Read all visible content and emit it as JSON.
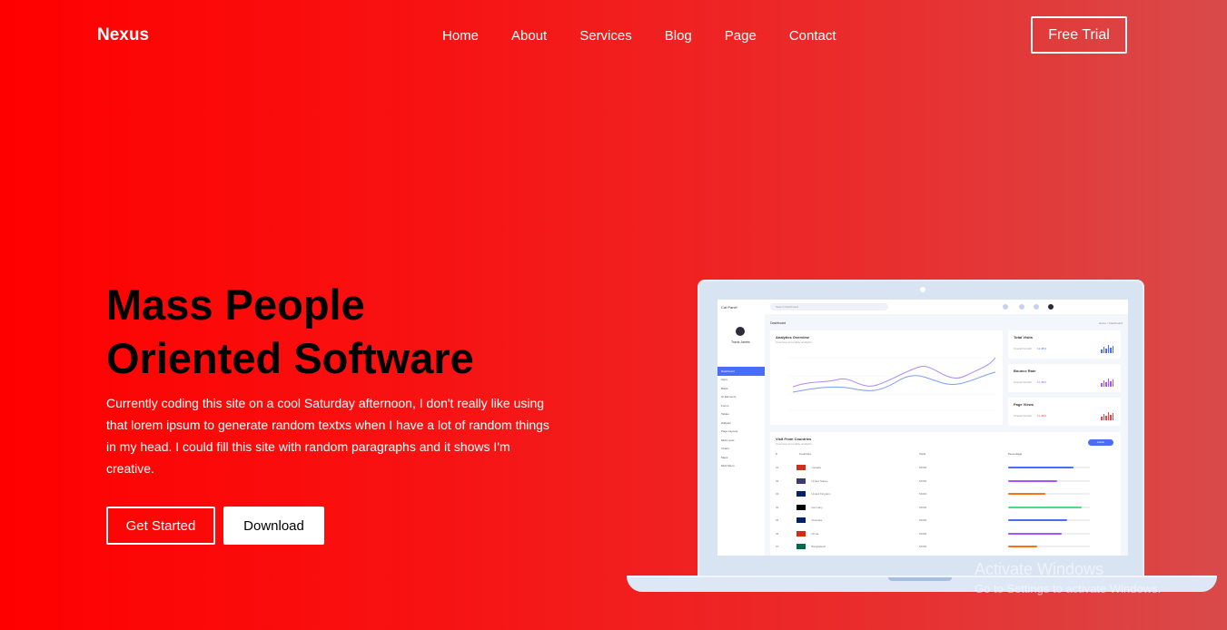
{
  "brand": "Nexus",
  "nav": [
    "Home",
    "About",
    "Services",
    "Blog",
    "Page",
    "Contact"
  ],
  "cta": "Free Trial",
  "hero": {
    "title_line1": "Mass People",
    "title_line2": "Oriented Software",
    "text": "Currently coding this site on a cool Saturday afternoon, I don't really like using that lorem ipsum to generate random textxs when I have a lot of random things in my head. I could fill this site with random paragraphs and it shows I'm creative.",
    "btn_primary": "Get Started",
    "btn_secondary": "Download"
  },
  "dashboard": {
    "logo": "Cat Panel",
    "user": "Travis James",
    "search_placeholder": "Search Dashboard",
    "page": "Dashboard",
    "breadcrumb": "Home > Dashboard",
    "menu": [
      "Dashboard",
      "Apps",
      "Briefs",
      "UI Elements",
      "Forms",
      "Tables",
      "Widgets",
      "Page Layouts",
      "Multi Level",
      "Charts",
      "Maps",
      "Multi Menu"
    ],
    "analytics_title": "Analytics Overview",
    "analytics_sub": "Overview of monthly analytics",
    "stats": [
      {
        "label": "Total Visits",
        "sub": "Overall Growth",
        "value": "11.45%",
        "color": "#4a6cf7"
      },
      {
        "label": "Bounce Rate",
        "sub": "Overall Growth",
        "value": "11.45%",
        "color": "#a855f7"
      },
      {
        "label": "Page Views",
        "sub": "Overall Growth",
        "value": "11.45%",
        "color": "#ef4444"
      }
    ],
    "visits_title": "Visit From Countries",
    "visits_sub": "Overview of monthly analytics",
    "visits_btn": "Action",
    "table_headers": [
      "#",
      "Countries",
      "Visits",
      "Percentage"
    ],
    "countries": [
      {
        "n": "01",
        "name": "Canada",
        "visits": "54000",
        "pct": 0.8,
        "color": "#4a6cf7"
      },
      {
        "n": "02",
        "name": "United States",
        "visits": "54000",
        "pct": 0.6,
        "color": "#a855f7"
      },
      {
        "n": "03",
        "name": "United Kingdom",
        "visits": "54000",
        "pct": 0.45,
        "color": "#f97316"
      },
      {
        "n": "04",
        "name": "Germany",
        "visits": "54000",
        "pct": 0.9,
        "color": "#4ade80"
      },
      {
        "n": "05",
        "name": "Australia",
        "visits": "54000",
        "pct": 0.72,
        "color": "#4a6cf7"
      },
      {
        "n": "06",
        "name": "China",
        "visits": "54000",
        "pct": 0.65,
        "color": "#a855f7"
      },
      {
        "n": "07",
        "name": "Bangladesh",
        "visits": "54000",
        "pct": 0.35,
        "color": "#f97316"
      }
    ]
  },
  "watermark": {
    "line1": "Activate Windows",
    "line2": "Go to Settings to activate Windows."
  }
}
